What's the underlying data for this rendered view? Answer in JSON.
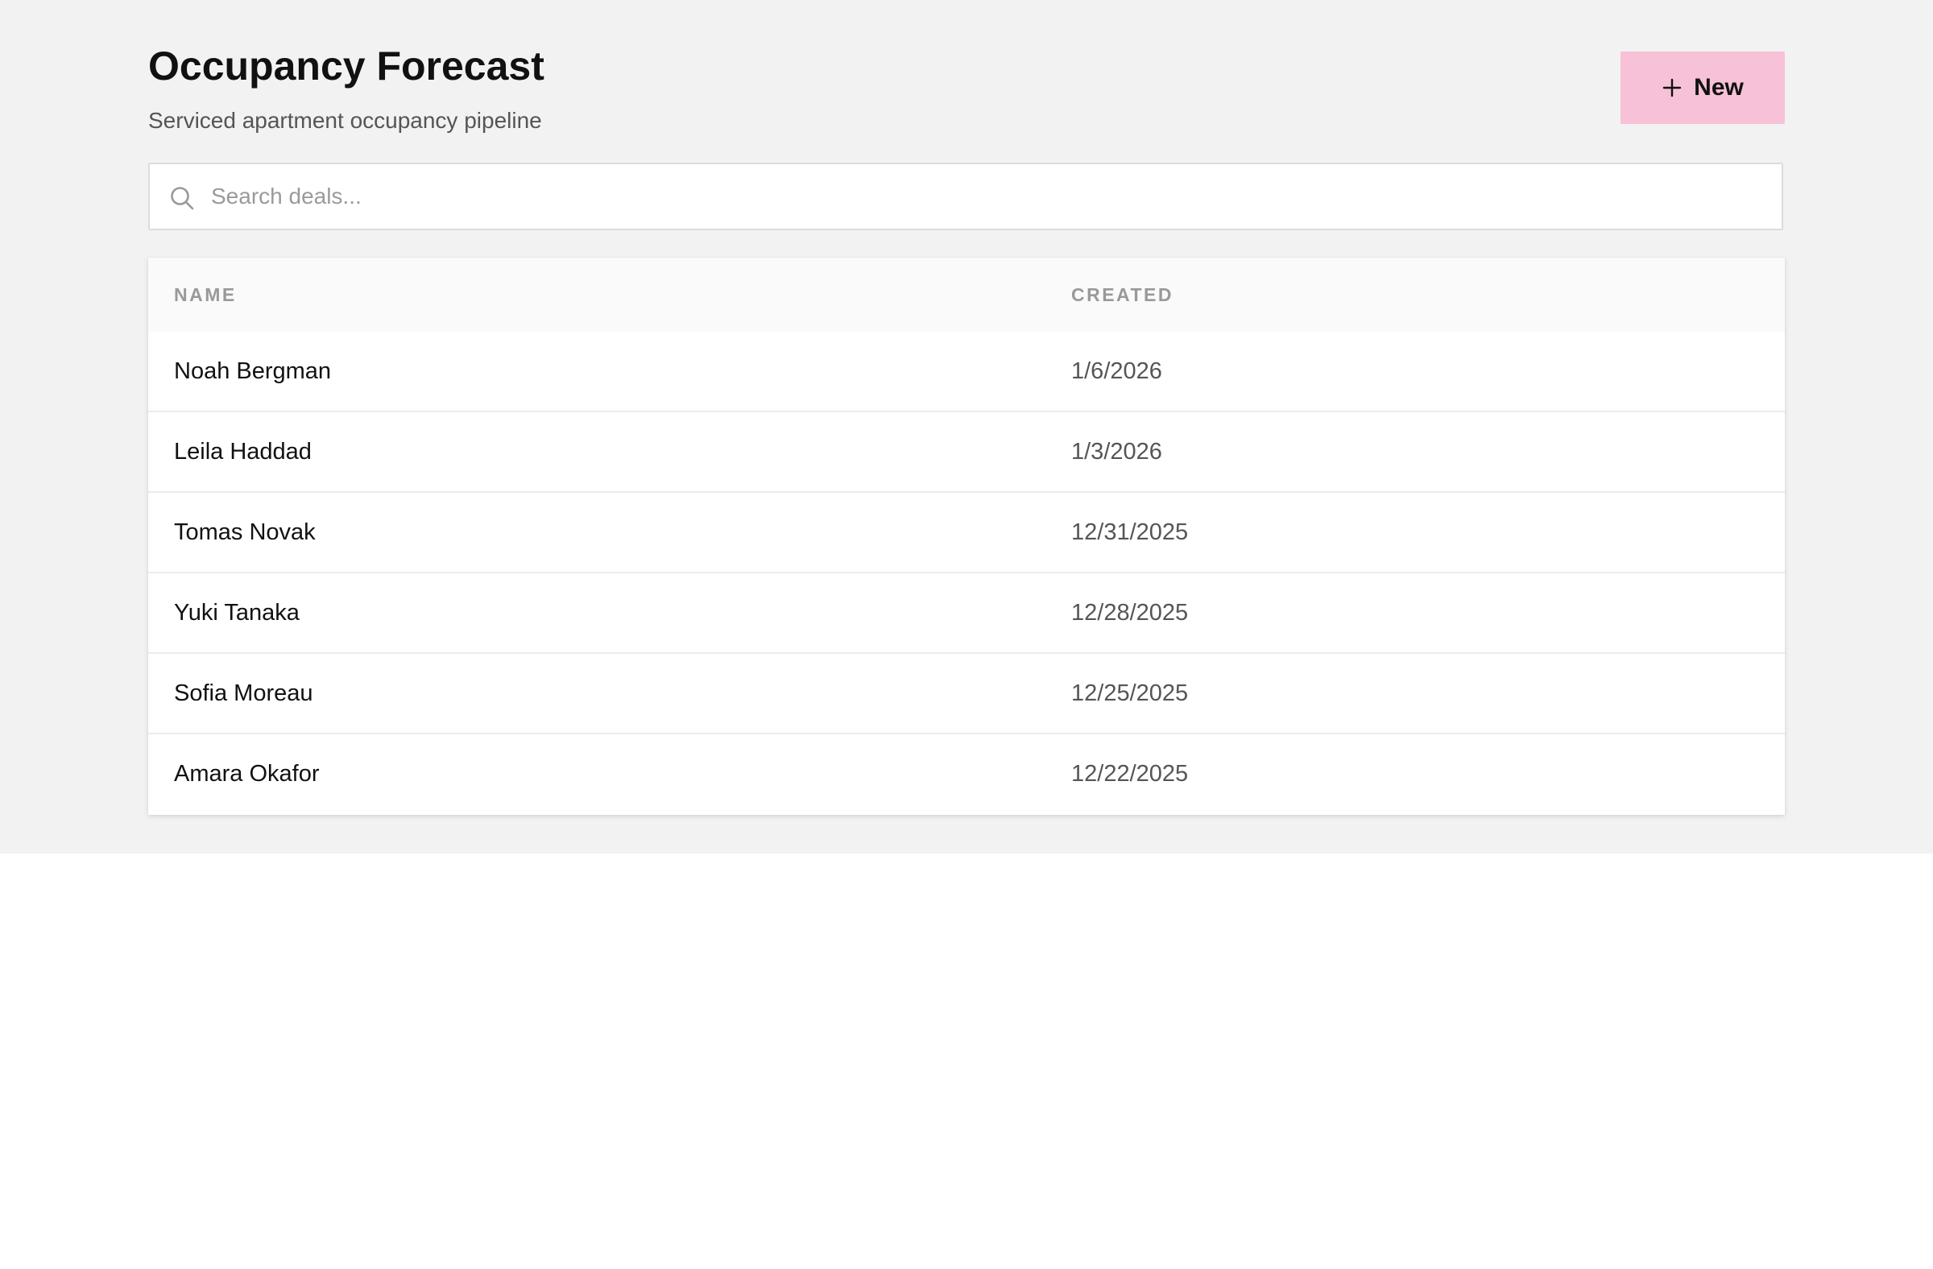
{
  "header": {
    "title": "Occupancy Forecast",
    "subtitle": "Serviced apartment occupancy pipeline",
    "new_button_label": "New"
  },
  "search": {
    "placeholder": "Search deals...",
    "value": ""
  },
  "table": {
    "columns": [
      "NAME",
      "CREATED"
    ],
    "rows": [
      {
        "name": "Noah Bergman",
        "created": "1/6/2026"
      },
      {
        "name": "Leila Haddad",
        "created": "1/3/2026"
      },
      {
        "name": "Tomas Novak",
        "created": "12/31/2025"
      },
      {
        "name": "Yuki Tanaka",
        "created": "12/28/2025"
      },
      {
        "name": "Sofia Moreau",
        "created": "12/25/2025"
      },
      {
        "name": "Amara Okafor",
        "created": "12/22/2025"
      }
    ]
  },
  "icons": {
    "new_button": "plus-icon",
    "search": "search-icon"
  },
  "colors": {
    "page_background": "#f2f2f2",
    "accent_button": "#f7c1d7",
    "header_background": "#fafafa"
  }
}
